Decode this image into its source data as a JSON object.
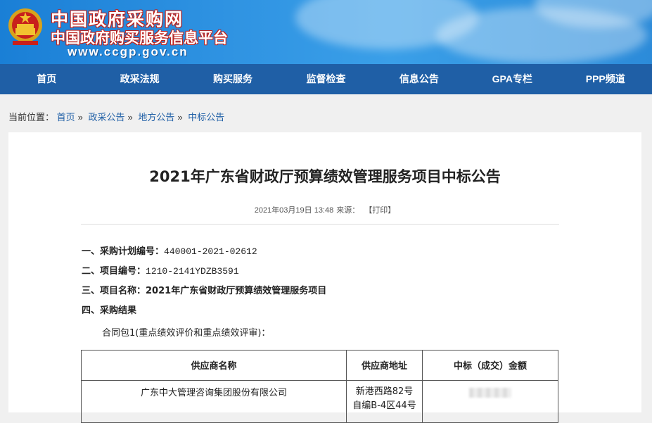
{
  "header": {
    "site_name": "中国政府采购网",
    "site_sub": "中国政府购买服务信息平台",
    "site_url": "www.ccgp.gov.cn"
  },
  "nav": {
    "items": [
      "首页",
      "政采法规",
      "购买服务",
      "监督检查",
      "信息公告",
      "GPA专栏",
      "PPP频道"
    ]
  },
  "breadcrumb": {
    "prefix": "当前位置：",
    "items": [
      "首页",
      "政采公告",
      "地方公告",
      "中标公告"
    ],
    "separator": "»"
  },
  "article": {
    "title": "2021年广东省财政厅预算绩效管理服务项目中标公告",
    "date": "2021年03月19日 13:48",
    "source_label": "来源：",
    "print_label": "【打印】",
    "lines": [
      {
        "label": "一、采购计划编号：",
        "value": "440001-2021-02612"
      },
      {
        "label": "二、项目编号：",
        "value": "1210-2141YDZB3591"
      },
      {
        "label": "三、项目名称：",
        "value": "2021年广东省财政厅预算绩效管理服务项目"
      },
      {
        "label": "四、采购结果",
        "value": ""
      }
    ],
    "package": "合同包1(重点绩效评价和重点绩效评审)：",
    "table": {
      "headers": [
        "供应商名称",
        "供应商地址",
        "中标（成交）金额"
      ],
      "rows": [
        {
          "name": "广东中大管理咨询集团股份有限公司",
          "address_line1": "新港西路82号",
          "address_line2": "自编B-4区44号"
        }
      ]
    }
  }
}
